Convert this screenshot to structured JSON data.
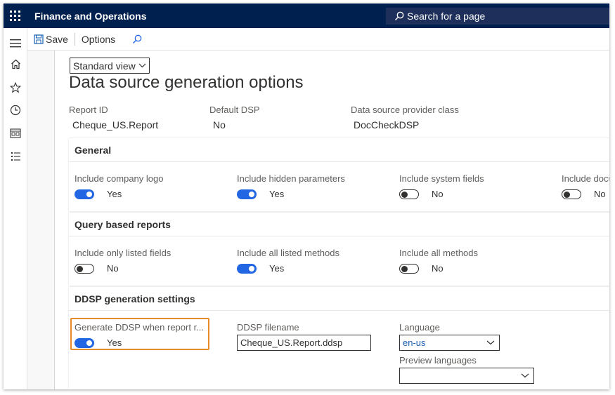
{
  "app": {
    "title": "Finance and Operations"
  },
  "search": {
    "placeholder": "Search for a page"
  },
  "nav_icons": [
    "hamburger-icon",
    "home-icon",
    "star-icon",
    "clock-icon",
    "workspace-icon",
    "list-icon"
  ],
  "actionpane": {
    "save_label": "Save",
    "options_label": "Options"
  },
  "view": {
    "selected": "Standard view"
  },
  "page": {
    "title": "Data source generation options"
  },
  "header_fields": [
    {
      "label": "Report ID",
      "value": "Cheque_US.Report"
    },
    {
      "label": "Default DSP",
      "value": "No"
    },
    {
      "label": "Data source provider class",
      "value": "DocCheckDSP"
    }
  ],
  "sections": {
    "general": {
      "title": "General",
      "fields": [
        {
          "label": "Include company logo",
          "value": "Yes",
          "on": true
        },
        {
          "label": "Include hidden parameters",
          "value": "Yes",
          "on": true
        },
        {
          "label": "Include system fields",
          "value": "No",
          "on": false
        },
        {
          "label": "Include docu",
          "value": "No",
          "on": false
        }
      ]
    },
    "query": {
      "title": "Query based reports",
      "fields": [
        {
          "label": "Include only listed fields",
          "value": "No",
          "on": false
        },
        {
          "label": "Include all listed methods",
          "value": "Yes",
          "on": true
        },
        {
          "label": "Include all methods",
          "value": "No",
          "on": false
        }
      ]
    },
    "ddsp": {
      "title": "DDSP generation settings",
      "generate": {
        "label": "Generate DDSP when report r...",
        "value": "Yes",
        "on": true
      },
      "filename": {
        "label": "DDSP filename",
        "value": "Cheque_US.Report.ddsp"
      },
      "language": {
        "label": "Language",
        "value": "en-us"
      },
      "preview": {
        "label": "Preview languages",
        "value": ""
      }
    }
  },
  "colors": {
    "topbar": "#002050",
    "accent": "#2266e3",
    "highlight": "#e8892a"
  }
}
